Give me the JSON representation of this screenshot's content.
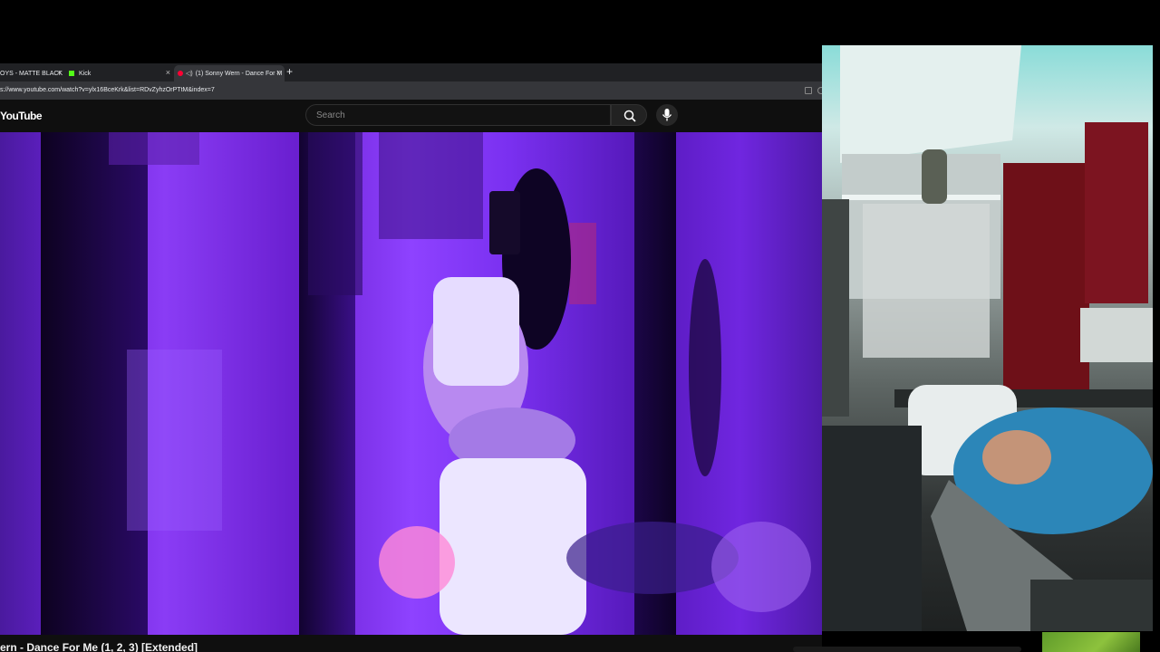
{
  "browser": {
    "tabs": [
      {
        "label": "OYS - MATTE BLACK",
        "close": "×"
      },
      {
        "label": "Kick",
        "close": "×"
      },
      {
        "label": "(1) Sonny Wern - Dance For M",
        "close": "×",
        "active": true
      }
    ],
    "new_tab": "+",
    "url": "s://www.youtube.com/watch?v=ylx16BceKrk&list=RDvZyhzOrPTtM&index=7"
  },
  "youtube": {
    "logo": "YouTube",
    "search_placeholder": "Search"
  },
  "video": {
    "title": "ern - Dance For Me (1, 2, 3) [Extended]"
  },
  "icons": {
    "search": "search-icon",
    "mic": "mic-icon",
    "kick": "kick-favicon-icon",
    "youtube": "youtube-favicon-icon",
    "audio": "speaker-icon"
  },
  "colors": {
    "video_tint": "#7a30f0",
    "kick_green": "#53fc18",
    "yt_red": "#ff0033"
  }
}
